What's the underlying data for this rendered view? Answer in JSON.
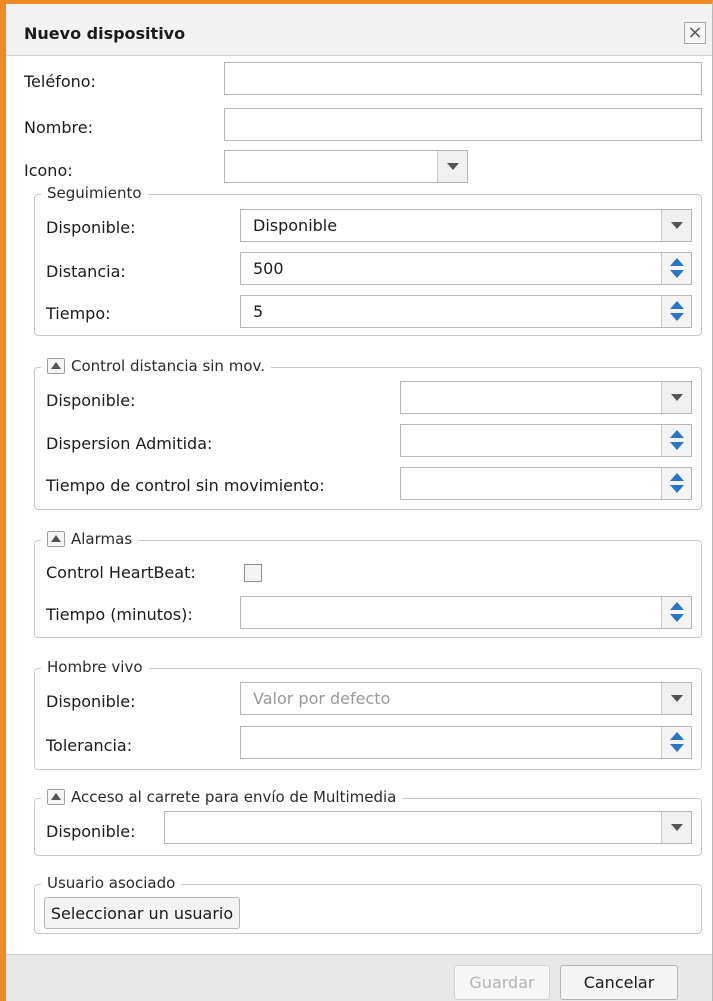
{
  "dialog": {
    "title": "Nuevo dispositivo",
    "close_icon": "close-icon",
    "close_glyph": "×"
  },
  "fields": {
    "telefono_label": "Teléfono:",
    "telefono_value": "",
    "nombre_label": "Nombre:",
    "nombre_value": "",
    "icono_label": "Icono:",
    "icono_value": ""
  },
  "seguimiento": {
    "legend": "Seguimiento",
    "disponible_label": "Disponible:",
    "disponible_value": "Disponible",
    "distancia_label": "Distancia:",
    "distancia_value": "500",
    "tiempo_label": "Tiempo:",
    "tiempo_value": "5"
  },
  "control_distancia": {
    "legend": "Control distancia sin mov.",
    "disponible_label": "Disponible:",
    "disponible_value": "",
    "dispersion_label": "Dispersion Admitida:",
    "dispersion_value": "",
    "tiempo_label": "Tiempo de control sin movimiento:",
    "tiempo_value": ""
  },
  "alarmas": {
    "legend": "Alarmas",
    "heartbeat_label": "Control HeartBeat:",
    "heartbeat_checked": false,
    "tiempo_label": "Tiempo (minutos):",
    "tiempo_value": ""
  },
  "hombre_vivo": {
    "legend": "Hombre vivo",
    "disponible_label": "Disponible:",
    "disponible_placeholder": "Valor por defecto",
    "tolerancia_label": "Tolerancia:",
    "tolerancia_value": ""
  },
  "carrete": {
    "legend": "Acceso al carrete para envío de Multimedia",
    "disponible_label": "Disponible:",
    "disponible_value": ""
  },
  "usuario": {
    "legend": "Usuario asociado",
    "select_button": "Seleccionar un usuario"
  },
  "footer": {
    "save_label": "Guardar",
    "save_enabled": false,
    "cancel_label": "Cancelar"
  },
  "colors": {
    "window_border": "#f08a24",
    "spinner_arrow": "#2a76c6"
  }
}
